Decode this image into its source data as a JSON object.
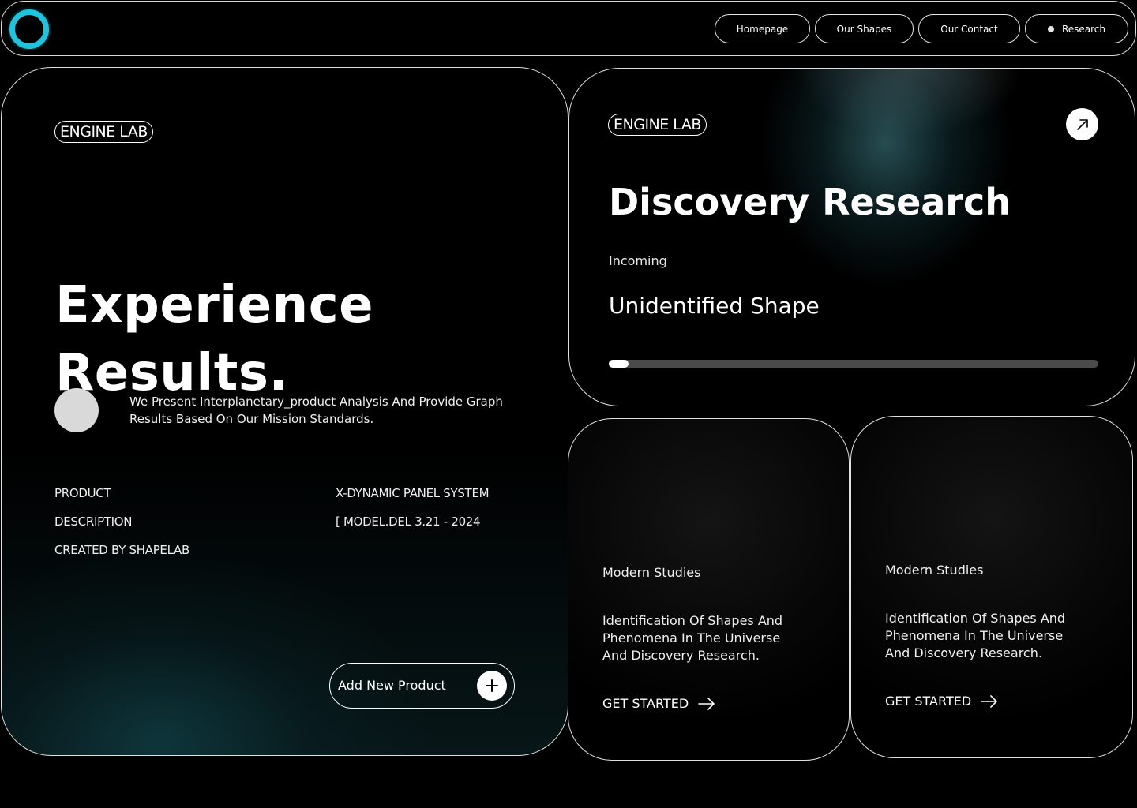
{
  "header": {
    "nav": [
      {
        "label": "Homepage"
      },
      {
        "label": "Our Shapes"
      },
      {
        "label": "Our Contact"
      },
      {
        "label": "Research"
      }
    ]
  },
  "hero": {
    "tag": "ENGINE LAB",
    "title_line1": "Experience",
    "title_line2": "Results.",
    "intro": "We Present Interplanetary_product Analysis And Provide Graph Results Based On Our Mission Standards.",
    "meta_left": [
      "PRODUCT",
      "DESCRIPTION",
      "CREATED BY SHAPELAB"
    ],
    "meta_right": [
      "X-DYNAMIC PANEL SYSTEM",
      "[ MODEL.DEL 3.21 - 2024"
    ],
    "add_button": "Add New Product"
  },
  "research": {
    "tag": "ENGINE LAB",
    "title": "Discovery Research",
    "status": "Incoming",
    "shape": "Unidentified Shape",
    "progress_percent": 4
  },
  "cards": [
    {
      "title": "Modern Studies",
      "description": "Identification Of Shapes And Phenomena In The Universe And Discovery Research.",
      "cta": "GET STARTED"
    },
    {
      "title": "Modern Studies",
      "description": "Identification Of Shapes And Phenomena In The Universe And Discovery Research.",
      "cta": "GET STARTED"
    }
  ],
  "colors": {
    "accent": "#1fc4dc",
    "background": "#000000",
    "teal_glow": "#145058"
  },
  "icons": {
    "logo": "ring-logo-icon",
    "arrow": "arrow-up-right-icon",
    "plus": "plus-icon",
    "cta": "arrow-right-icon"
  }
}
